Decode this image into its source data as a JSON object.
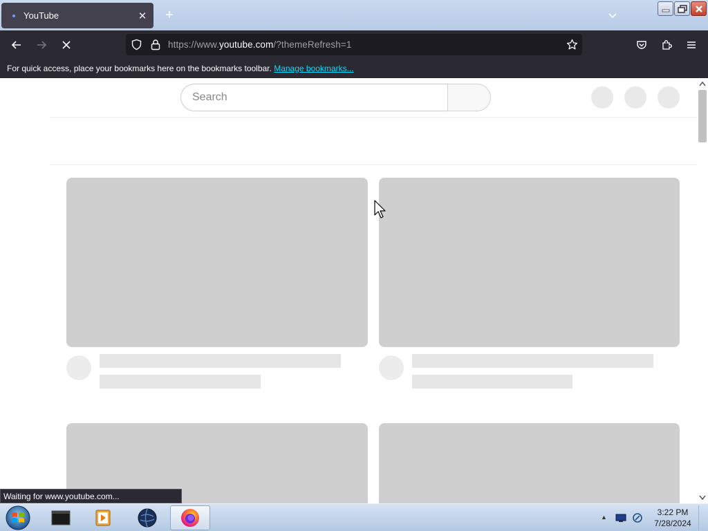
{
  "browser": {
    "tab_title": "YouTube",
    "url_prefix": "https://www.",
    "url_host": "youtube.com",
    "url_suffix": "/?themeRefresh=1",
    "bookmarks_message": "For quick access, place your bookmarks here on the bookmarks toolbar.",
    "bookmarks_link": "Manage bookmarks...",
    "status_text": "Waiting for www.youtube.com..."
  },
  "youtube": {
    "search_placeholder": "Search"
  },
  "taskbar": {
    "apps": [
      "terminal-app",
      "media-player-app",
      "network-app",
      "firefox-app"
    ],
    "active_app": "firefox-app",
    "time": "3:22 PM",
    "date": "7/28/2024"
  },
  "colors": {
    "browser_chrome": "#2b2a33",
    "url_field": "#1c1b22",
    "placeholder_gray": "#cfcfcf",
    "link": "#00ddff"
  }
}
